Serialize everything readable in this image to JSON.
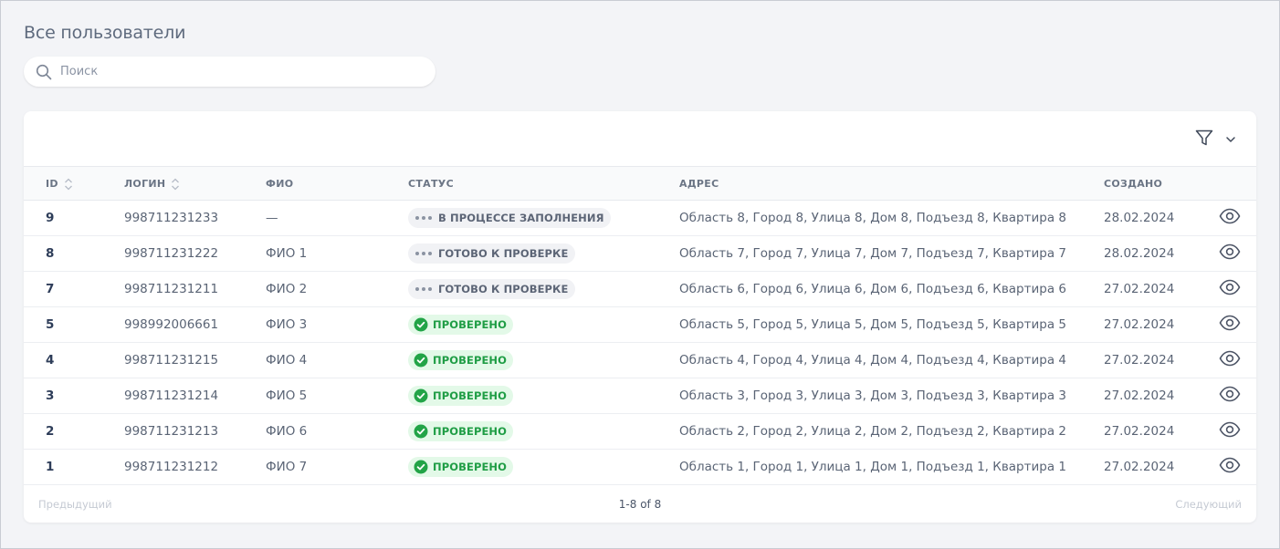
{
  "page": {
    "title": "Все пользователи"
  },
  "search": {
    "placeholder": "Поиск",
    "value": ""
  },
  "toolbar": {
    "filter_icon": "filter-icon",
    "dropdown_icon": "chevron-down-icon"
  },
  "table": {
    "columns": [
      {
        "key": "id",
        "label": "ID",
        "sortable": true
      },
      {
        "key": "login",
        "label": "ЛОГИН",
        "sortable": true
      },
      {
        "key": "fio",
        "label": "ФИО",
        "sortable": false
      },
      {
        "key": "status",
        "label": "СТАТУС",
        "sortable": false
      },
      {
        "key": "address",
        "label": "АДРЕС",
        "sortable": false
      },
      {
        "key": "created",
        "label": "СОЗДАНО",
        "sortable": false
      }
    ],
    "rows": [
      {
        "id": "9",
        "login": "998711231233",
        "fio": "—",
        "status": "В ПРОЦЕССЕ ЗАПОЛНЕНИЯ",
        "status_type": "progress",
        "address": "Область 8, Город 8, Улица 8, Дом 8, Подъезд 8, Квартира 8",
        "created": "28.02.2024"
      },
      {
        "id": "8",
        "login": "998711231222",
        "fio": "ФИО 1",
        "status": "ГОТОВО К ПРОВЕРКЕ",
        "status_type": "progress",
        "address": "Область 7, Город 7, Улица 7, Дом 7, Подъезд 7, Квартира 7",
        "created": "28.02.2024"
      },
      {
        "id": "7",
        "login": "998711231211",
        "fio": "ФИО 2",
        "status": "ГОТОВО К ПРОВЕРКЕ",
        "status_type": "progress",
        "address": "Область 6, Город 6, Улица 6, Дом 6, Подъезд 6, Квартира 6",
        "created": "27.02.2024"
      },
      {
        "id": "5",
        "login": "998992006661",
        "fio": "ФИО 3",
        "status": "ПРОВЕРЕНО",
        "status_type": "verified",
        "address": "Область 5, Город 5, Улица 5, Дом 5, Подъезд 5, Квартира 5",
        "created": "27.02.2024"
      },
      {
        "id": "4",
        "login": "998711231215",
        "fio": "ФИО 4",
        "status": "ПРОВЕРЕНО",
        "status_type": "verified",
        "address": "Область 4, Город 4, Улица 4, Дом 4, Подъезд 4, Квартира 4",
        "created": "27.02.2024"
      },
      {
        "id": "3",
        "login": "998711231214",
        "fio": "ФИО 5",
        "status": "ПРОВЕРЕНО",
        "status_type": "verified",
        "address": "Область 3, Город 3, Улица 3, Дом 3, Подъезд 3, Квартира 3",
        "created": "27.02.2024"
      },
      {
        "id": "2",
        "login": "998711231213",
        "fio": "ФИО 6",
        "status": "ПРОВЕРЕНО",
        "status_type": "verified",
        "address": "Область 2, Город 2, Улица 2, Дом 2, Подъезд 2, Квартира 2",
        "created": "27.02.2024"
      },
      {
        "id": "1",
        "login": "998711231212",
        "fio": "ФИО 7",
        "status": "ПРОВЕРЕНО",
        "status_type": "verified",
        "address": "Область 1, Город 1, Улица 1, Дом 1, Подъезд 1, Квартира 1",
        "created": "27.02.2024"
      }
    ],
    "row_action_icon": "eye-icon"
  },
  "pagination": {
    "prev_label": "Предыдущий",
    "info": "1-8 of 8",
    "next_label": "Следующий"
  },
  "colors": {
    "verified_text": "#1f9d45",
    "verified_bg": "#e3f9e8",
    "progress_bg": "#f1f2f5",
    "id_text": "#2e3d59"
  }
}
